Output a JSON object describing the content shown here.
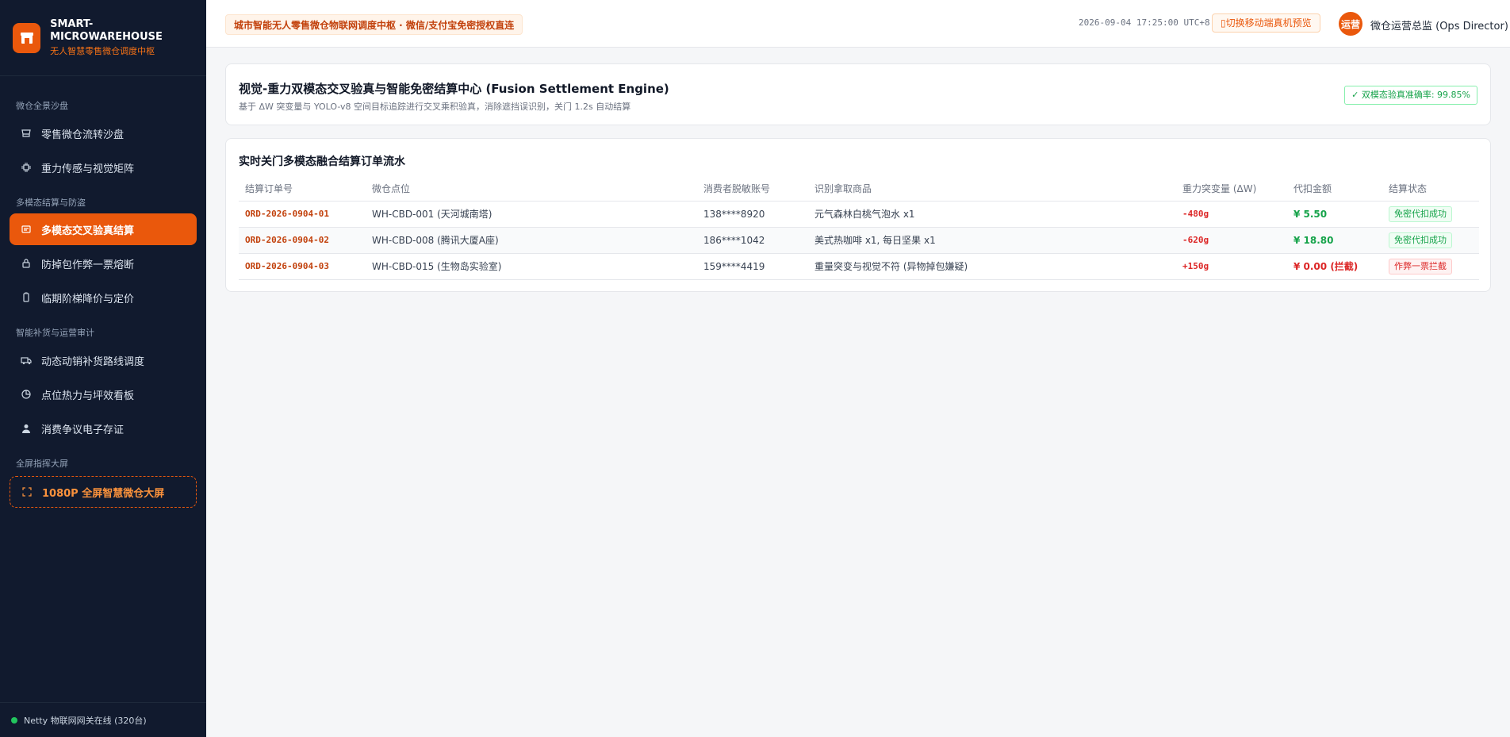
{
  "brand": {
    "name": "SMART-MICROWAREHOUSE",
    "subtitle": "无人智慧零售微仓调度中枢"
  },
  "sidebar": {
    "sections": [
      {
        "title": "微仓全景沙盘"
      },
      {
        "title": "多模态结算与防盗"
      },
      {
        "title": "智能补货与运营审计"
      },
      {
        "title": "全屏指挥大屏"
      }
    ],
    "items": [
      {
        "label": "零售微仓流转沙盘",
        "icon": "store-icon"
      },
      {
        "label": "重力传感与视觉矩阵",
        "icon": "chip-icon"
      },
      {
        "label": "多模态交叉验真结算",
        "icon": "scan-icon",
        "active": true
      },
      {
        "label": "防掉包作弊一票熔断",
        "icon": "lock-icon"
      },
      {
        "label": "临期阶梯降价与定价",
        "icon": "tag-icon"
      },
      {
        "label": "动态动销补货路线调度",
        "icon": "truck-icon"
      },
      {
        "label": "点位热力与坪效看板",
        "icon": "pie-icon"
      },
      {
        "label": "消费争议电子存证",
        "icon": "user-icon"
      },
      {
        "label": "1080P 全屏智慧微仓大屏",
        "icon": "fullscreen-icon"
      }
    ],
    "footer": "Netty 物联网网关在线 (320台)"
  },
  "header": {
    "hub_badge": "城市智能无人零售微仓物联网调度中枢 · 微信/支付宝免密授权直连",
    "time": "2026-09-04 17:25:00 UTC+8",
    "mobile_button": "切换移动端真机预览",
    "avatar": "运营",
    "user": "微仓运营总监 (Ops Director)"
  },
  "engine": {
    "title": "视觉-重力双模态交叉验真与智能免密结算中心 (Fusion Settlement Engine)",
    "subtitle": "基于 ΔW 突变量与 YOLO-v8 空间目标追踪进行交叉乘积验真，消除遮挡误识别，关门 1.2s 自动结算",
    "accuracy": "双模态验真准确率: 99.85%"
  },
  "orders": {
    "title": "实时关门多模态融合结算订单流水",
    "columns": [
      "结算订单号",
      "微仓点位",
      "消费者脱敏账号",
      "识别拿取商品",
      "重力突变量 (ΔW)",
      "代扣金额",
      "结算状态"
    ],
    "rows": [
      {
        "id": "ORD-2026-0904-01",
        "location": "WH-CBD-001 (天河城南塔)",
        "account": "138****8920",
        "items": "元气森林白桃气泡水 x1",
        "delta": "-480g",
        "amount": "¥ 5.50",
        "status": "免密代扣成功",
        "state": "ok"
      },
      {
        "id": "ORD-2026-0904-02",
        "location": "WH-CBD-008 (腾讯大厦A座)",
        "account": "186****1042",
        "items": "美式热咖啡 x1, 每日坚果 x1",
        "delta": "-620g",
        "amount": "¥ 18.80",
        "status": "免密代扣成功",
        "state": "ok"
      },
      {
        "id": "ORD-2026-0904-03",
        "location": "WH-CBD-015 (生物岛实验室)",
        "account": "159****4419",
        "items": "重量突变与视觉不符 (异物掉包嫌疑)",
        "delta": "+150g",
        "amount": "¥ 0.00 (拦截)",
        "status": "作弊一票拦截",
        "state": "bad"
      }
    ]
  },
  "colors": {
    "accent": "#ea580c",
    "sidebar_bg": "#111a2e",
    "success": "#16a34a",
    "danger": "#dc2626"
  }
}
